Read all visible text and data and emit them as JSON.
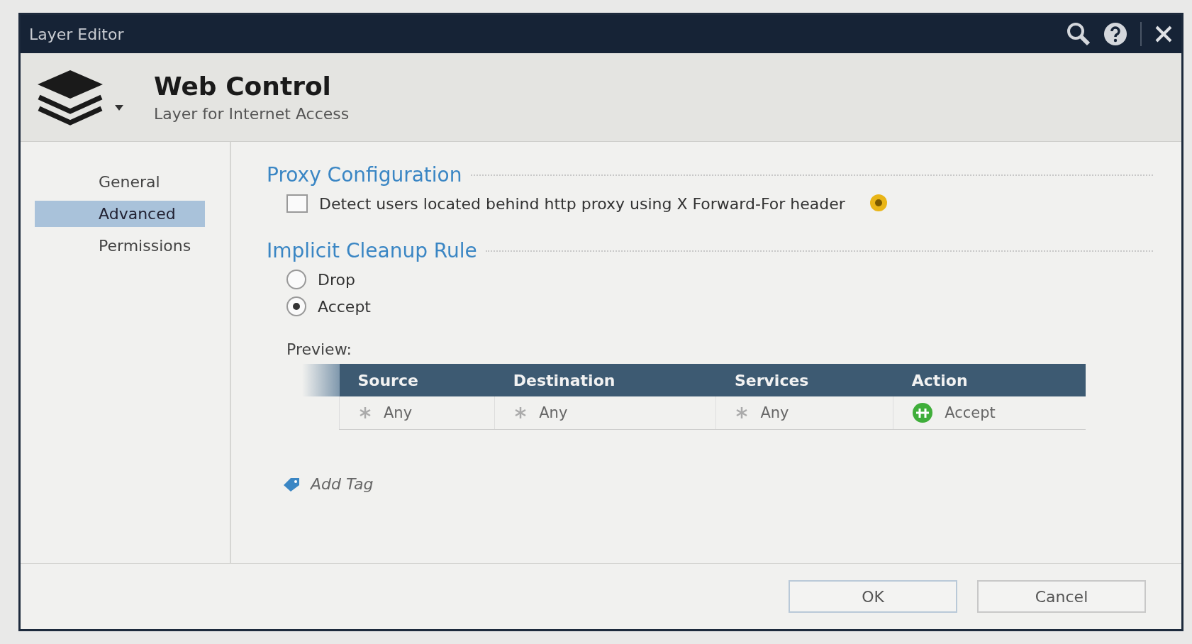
{
  "window": {
    "title": "Layer Editor"
  },
  "header": {
    "title": "Web Control",
    "subtitle": "Layer for Internet Access"
  },
  "sidebar": {
    "items": [
      {
        "label": "General",
        "selected": false
      },
      {
        "label": "Advanced",
        "selected": true
      },
      {
        "label": "Permissions",
        "selected": false
      }
    ]
  },
  "proxy": {
    "heading": "Proxy Configuration",
    "checkbox": {
      "label": "Detect users located behind http proxy using X Forward-For header",
      "checked": false
    }
  },
  "cleanup": {
    "heading": "Implicit Cleanup Rule",
    "options": [
      {
        "label": "Drop",
        "selected": false
      },
      {
        "label": "Accept",
        "selected": true
      }
    ]
  },
  "preview": {
    "label": "Preview:",
    "columns": [
      "Source",
      "Destination",
      "Services",
      "Action"
    ],
    "rows": [
      [
        {
          "text": "Any",
          "kind": "any"
        },
        {
          "text": "Any",
          "kind": "any"
        },
        {
          "text": "Any",
          "kind": "any"
        },
        {
          "text": "Accept",
          "kind": "accept"
        }
      ]
    ]
  },
  "add_tag": "Add Tag",
  "buttons": [
    {
      "label": "OK",
      "kind": "primary"
    },
    {
      "label": "Cancel",
      "kind": "secondary"
    }
  ]
}
